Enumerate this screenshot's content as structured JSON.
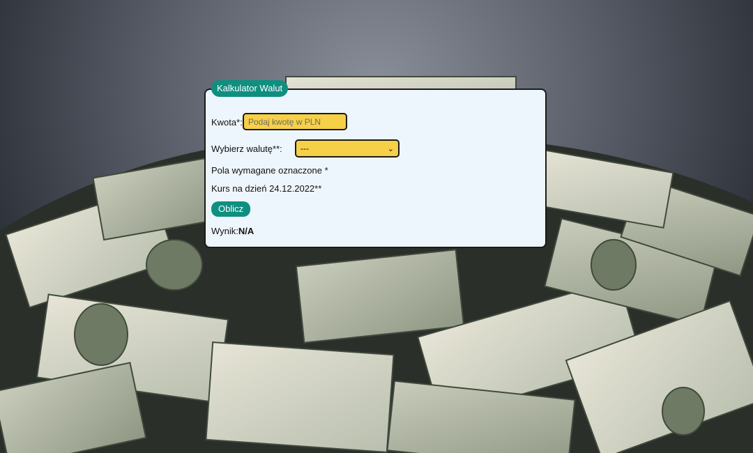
{
  "form": {
    "legend": "Kalkulator Walut",
    "amount_label": "Kwota*:",
    "amount_placeholder": "Podaj kwotę w PLN",
    "currency_label": "Wybierz walutę**:",
    "currency_selected": "---",
    "required_note": "Pola wymagane oznaczone *",
    "rate_note": "Kurs na dzień 24.12.2022**",
    "calculate_label": "Oblicz",
    "result_label": "Wynik:",
    "result_value": "N/A"
  },
  "colors": {
    "accent": "#0f8f80",
    "field_bg": "#f6d046",
    "panel_bg": "#eef6fd"
  }
}
